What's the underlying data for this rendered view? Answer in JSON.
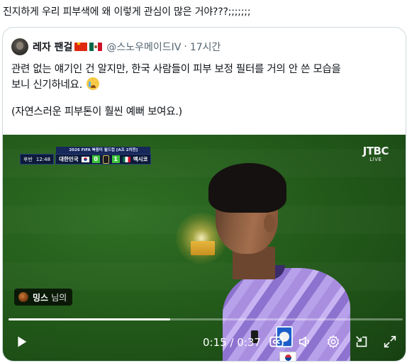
{
  "post": {
    "text": "진지하게 우리 피부색에 왜 이렇게 관심이 많은 거야???;;;;;;;"
  },
  "quoted": {
    "display_name": "레자 팬걸",
    "handle": "@스노우메이드IV",
    "separator": "·",
    "time": "17시간",
    "flags": [
      "china-flag",
      "mexico-flag"
    ],
    "body_line1": "관련 없는 얘기인 건 알지만, 한국 사람들이 피부 보정 필터를 거의 안 쓴 모습을",
    "body_line2": "보니 신기하네요.",
    "body_emoji": "crying-face-emoji",
    "body_line3": "(자연스러운 피부톤이 훨씬 예뻐 보여요.)"
  },
  "video": {
    "scorebug": {
      "title": "2026 FIFA 북중미 월드컵 [A조 2차전]",
      "half": "후반",
      "clock": "12:48",
      "home_team": "대한민국",
      "home_score": "0",
      "away_score": "1",
      "away_team": "멕시코"
    },
    "broadcaster": {
      "logo": "JTBC",
      "badge": "LIVE"
    },
    "source_tag": {
      "name": "밍스",
      "suffix": "님의"
    },
    "progress": 0.41,
    "current_time": "0:15",
    "duration": "0:37",
    "time_separator": " / ",
    "controls": [
      "play-icon",
      "captions-icon",
      "volume-icon",
      "settings-icon",
      "minimize-icon",
      "fullscreen-icon"
    ]
  },
  "colors": {
    "text_primary": "#0f1419",
    "text_secondary": "#536471",
    "card_border": "#cfd9de",
    "score_green": "#3ec43e",
    "scorebug_navy": "#0c1a3a"
  }
}
